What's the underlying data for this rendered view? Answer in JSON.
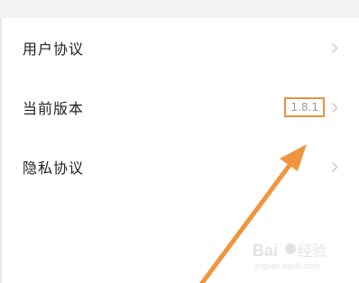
{
  "settings": {
    "items": [
      {
        "label": "用户协议",
        "value": ""
      },
      {
        "label": "当前版本",
        "value": "1.8.1"
      },
      {
        "label": "隐私协议",
        "value": ""
      }
    ]
  },
  "annotation": {
    "highlight_color": "#e8903f",
    "arrow_color": "#f0953f"
  },
  "watermark": {
    "brand": "Baidu 经验",
    "url": "jingyan.baidu.com"
  },
  "icons": {
    "chevron": "chevron-right-icon"
  }
}
